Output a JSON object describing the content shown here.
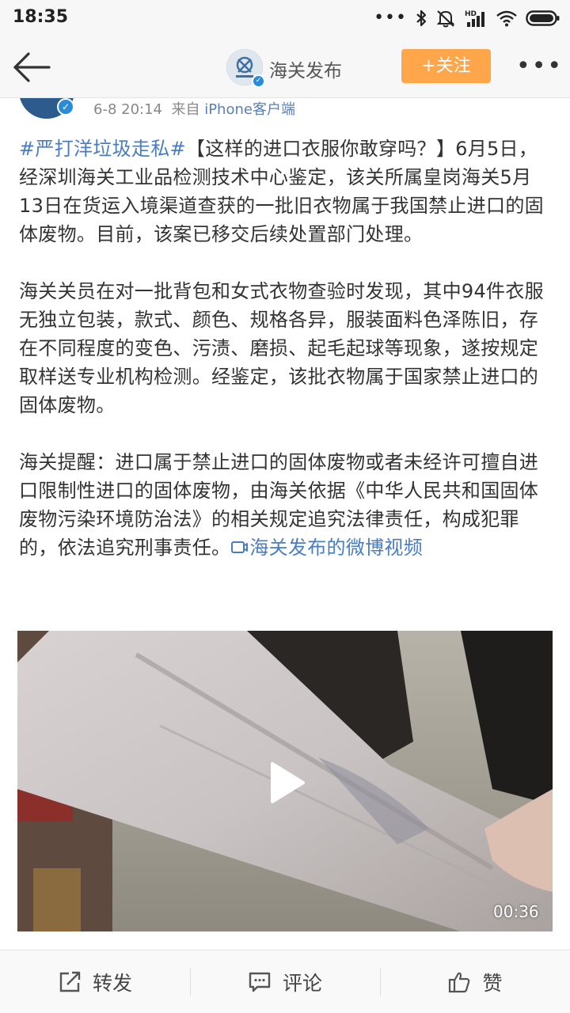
{
  "status_bar": {
    "time": "18:35",
    "more_dots": "•••",
    "icons": [
      "bluetooth-icon",
      "mute-icon",
      "hd-signal-icon",
      "wifi-icon",
      "battery-icon"
    ]
  },
  "nav": {
    "title": "海关发布",
    "follow_label": "+关注",
    "more_label": "•••"
  },
  "post": {
    "time": "6-8 20:14",
    "from_prefix": "来自",
    "source": "iPhone客户端",
    "hashtag": "#严打洋垃圾走私#",
    "para1_rest": "【这样的进口衣服你敢穿吗？】6月5日，经深圳海关工业品检测技术中心鉴定，该关所属皇岗海关5月13日在货运入境渠道查获的一批旧衣物属于我国禁止进口的固体废物。目前，该案已移交后续处置部门处理。",
    "para2": "海关关员在对一批背包和女式衣物查验时发现，其中94件衣服无独立包装，款式、颜色、规格各异，服装面料色泽陈旧，存在不同程度的变色、污渍、磨损、起毛起球等现象，遂按规定取样送专业机构检测。经鉴定，该批衣物属于国家禁止进口的固体废物。",
    "para3": "海关提醒：进口属于禁止进口的固体废物或者未经许可擅自进口限制性进口的固体废物，由海关依据《中华人民共和国固体废物污染环境防治法》的相关规定追究法律责任，构成犯罪的，依法追究刑事责任。",
    "video_link": "海关发布的微博视频"
  },
  "video": {
    "duration": "00:36"
  },
  "actions": {
    "repost": "转发",
    "comment": "评论",
    "like": "赞"
  },
  "colors": {
    "follow_button": "#ffa64b",
    "link": "#4a7cc2",
    "verified_badge": "#2a8cd9"
  }
}
